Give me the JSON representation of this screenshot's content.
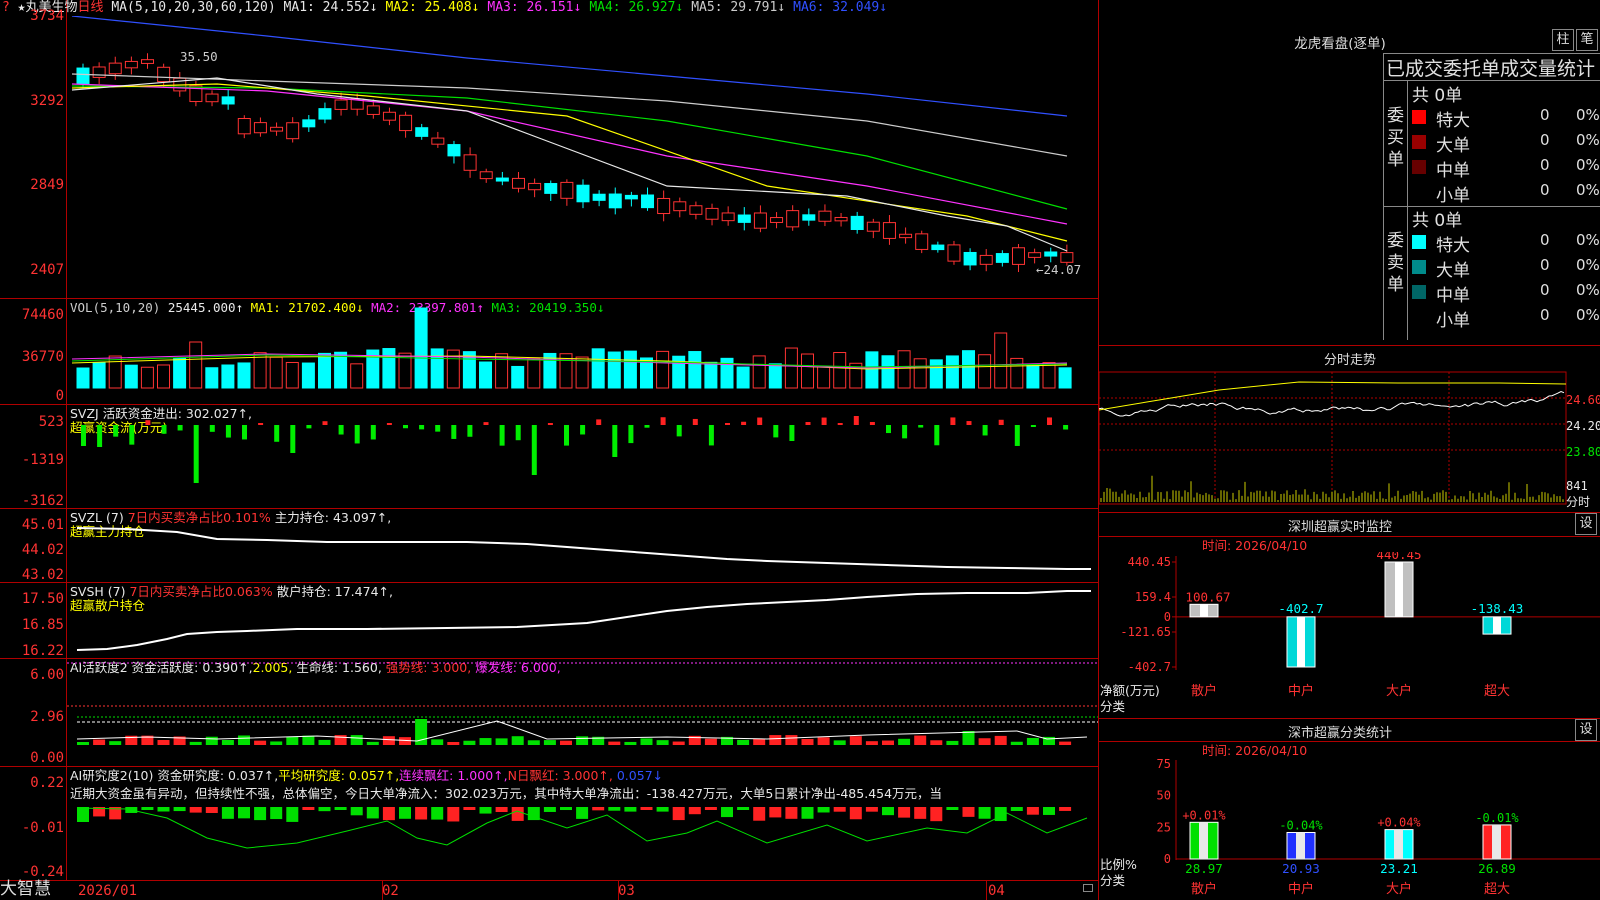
{
  "stock": {
    "name": "丸美生物",
    "period": "日线"
  },
  "main": {
    "ma_header": "MA(5,10,20,30,60,120)",
    "ma": [
      {
        "label": "MA1: 24.552↓",
        "color": "#e8e8e8"
      },
      {
        "label": "MA2: 25.408↓",
        "color": "#ffff00"
      },
      {
        "label": "MA3: 26.151↓",
        "color": "#ff33ff"
      },
      {
        "label": "MA4: 26.927↓",
        "color": "#00e000"
      },
      {
        "label": "MA5: 29.791↓",
        "color": "#cccccc"
      },
      {
        "label": "MA6: 32.049↓",
        "color": "#3050ff"
      }
    ],
    "y_ticks": [
      "3734",
      "3292",
      "2849",
      "2407"
    ],
    "high_label": "35.50",
    "low_label": "←24.07"
  },
  "vol": {
    "header": "VOL(5,10,20)",
    "value": "25445.000↑",
    "ma1": "MA1: 21702.400↓",
    "ma2": "MA2: 23397.801↑",
    "ma3": "MA3: 20419.350↓",
    "y_ticks": [
      "74460",
      "36770",
      "0"
    ]
  },
  "svzj": {
    "header": "SVZJ  活跃资金进出: 302.027↑,",
    "sub": "超赢资金流(万元)",
    "y_ticks": [
      "523",
      "-1319",
      "-3162"
    ]
  },
  "svzl": {
    "header": "SVZL (7)",
    "red": "7日内买卖净占比0.101%",
    "tail": "主力持仓: 43.097↑,",
    "sub": "超赢主力持仓",
    "y_ticks": [
      "45.01",
      "44.02",
      "43.02"
    ]
  },
  "svsh": {
    "header": "SVSH (7)",
    "red": "7日内买卖净占比0.063%",
    "tail": "散户持仓: 17.474↑,",
    "sub": "超赢散户持仓",
    "y_ticks": [
      "17.50",
      "16.85",
      "16.22"
    ]
  },
  "ai1": {
    "h1": "AI活跃度2 资金活跃度: 0.390↑,",
    "h2": "2.005,",
    "h3": "生命线: 1.560,",
    "h4": "强势线: 3.000,",
    "h5": "爆发线: 6.000,",
    "y_ticks": [
      "6.00",
      "2.96",
      "0.00"
    ]
  },
  "ai2": {
    "h1": "AI研究度2(10) 资金研究度: 0.037↑,",
    "h2": "平均研究度: 0.057↑,",
    "h3": "连续飘红: 1.000↑,",
    "h4": "N日飘红: 3.000↑,",
    "h5": "0.057↓",
    "text": "近期大资金虽有异动，但持续性不强，总体偏空，今日大单净流入：302.023万元，其中特大单净流出：-138.427万元，大单5日累计净出-485.454万元，当",
    "y_ticks": [
      "0.22",
      "-0.01",
      "-0.24"
    ]
  },
  "date_axis": {
    "labels": [
      "2026/01",
      "02",
      "03",
      "04"
    ]
  },
  "brand": "大智慧",
  "right": {
    "lhb": {
      "title": "龙虎看盘(逐单)",
      "btn1": "柱",
      "btn2": "笔",
      "subtitle": "已成交委托单成交量统计"
    },
    "buy": {
      "label": "委买单",
      "total": "共 0单",
      "rows": [
        {
          "name": "特大",
          "n": "0",
          "p": "0%",
          "color": "#ff0000"
        },
        {
          "name": "大单",
          "n": "0",
          "p": "0%",
          "color": "#990000"
        },
        {
          "name": "中单",
          "n": "0",
          "p": "0%",
          "color": "#660000"
        },
        {
          "name": "小单",
          "n": "0",
          "p": "0%",
          "color": "#000000"
        }
      ]
    },
    "sell": {
      "label": "委卖单",
      "total": "共 0单",
      "rows": [
        {
          "name": "特大",
          "n": "0",
          "p": "0%",
          "color": "#00ffff"
        },
        {
          "name": "大单",
          "n": "0",
          "p": "0%",
          "color": "#008b8b"
        },
        {
          "name": "中单",
          "n": "0",
          "p": "0%",
          "color": "#006666"
        },
        {
          "name": "小单",
          "n": "0",
          "p": "0%",
          "color": "#000000"
        }
      ]
    },
    "fs": {
      "title": "分时走势",
      "ticks": [
        "24.60",
        "24.20",
        "23.80",
        "841"
      ],
      "unit": "分时"
    },
    "monitor": {
      "title": "深圳超赢实时监控",
      "btn": "设",
      "time": "时间: 2026/04/10",
      "y_ticks": [
        "440.45",
        "159.4",
        "0",
        "-121.65",
        "-402.7"
      ],
      "ylabel1": "净额(万元)",
      "ylabel2": "分类",
      "bars": [
        {
          "cat": "散户",
          "label": "100.67",
          "v": 100.67
        },
        {
          "cat": "中户",
          "label": "-402.7",
          "v": -402.7
        },
        {
          "cat": "大户",
          "label": "440.45",
          "v": 440.45
        },
        {
          "cat": "超大",
          "label": "-138.43",
          "v": -138.43
        }
      ]
    },
    "classify": {
      "title": "深市超赢分类统计",
      "btn": "设",
      "time": "时间: 2026/04/10",
      "y_ticks": [
        "75",
        "50",
        "25",
        "0"
      ],
      "ylabel1": "比例%",
      "ylabel2": "分类",
      "bars": [
        {
          "cat": "散户",
          "top": "+0.01%",
          "val": "28.97",
          "v": 28.97
        },
        {
          "cat": "中户",
          "top": "-0.04%",
          "val": "20.93",
          "v": 20.93
        },
        {
          "cat": "大户",
          "top": "+0.04%",
          "val": "23.21",
          "v": 23.21
        },
        {
          "cat": "超大",
          "top": "-0.01%",
          "val": "26.89",
          "v": 26.89
        }
      ]
    }
  }
}
